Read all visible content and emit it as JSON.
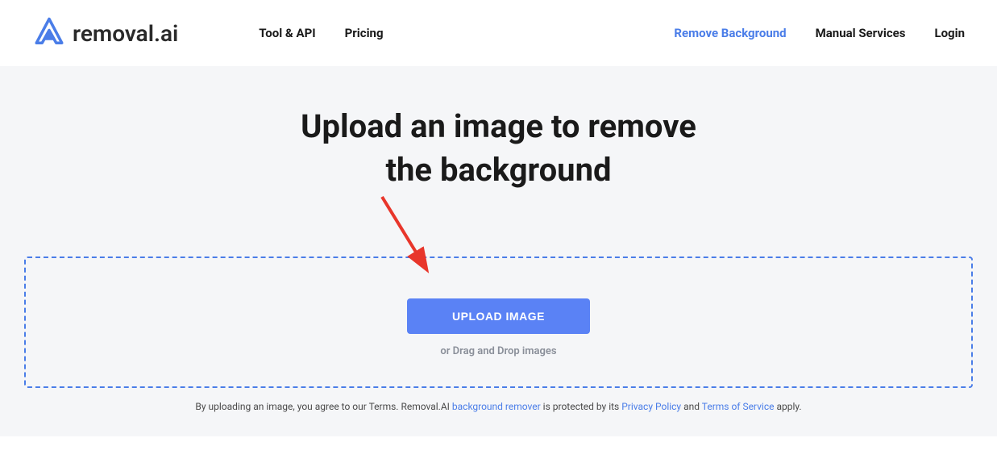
{
  "header": {
    "logo_text": "removal.ai",
    "nav_left": [
      {
        "label": "Tool & API"
      },
      {
        "label": "Pricing"
      }
    ],
    "nav_right": [
      {
        "label": "Remove Background",
        "active": true
      },
      {
        "label": "Manual Services"
      },
      {
        "label": "Login"
      }
    ]
  },
  "hero": {
    "title_line1": "Upload an image to remove",
    "title_line2": "the background",
    "upload_button": "UPLOAD IMAGE",
    "drag_text": "or Drag and Drop images"
  },
  "terms": {
    "prefix": "By uploading an image, you agree to our Terms. Removal.AI ",
    "link1": "background remover",
    "mid1": " is protected by its ",
    "link2": "Privacy Policy",
    "mid2": " and ",
    "link3": "Terms of Service",
    "suffix": " apply."
  }
}
